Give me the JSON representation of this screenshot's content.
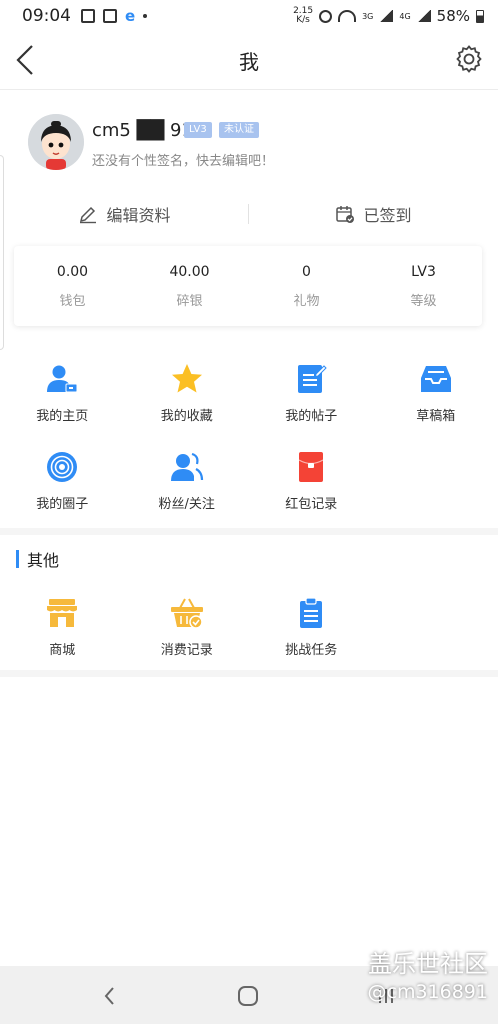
{
  "status_bar": {
    "time": "09:04",
    "net_speed_top": "2.15",
    "net_speed_bottom": "K/s",
    "net_3g": "3G",
    "net_4g": "4G",
    "battery": "58%"
  },
  "header": {
    "title": "我"
  },
  "profile": {
    "username": "cm5 ██ 91",
    "level_badge": "LV3",
    "auth_badge": "未认证",
    "signature": "还没有个性签名，快去编辑吧！"
  },
  "actions": {
    "edit_profile": "编辑资料",
    "checked_in": "已签到"
  },
  "stats": [
    {
      "value": "0.00",
      "label": "钱包"
    },
    {
      "value": "40.00",
      "label": "碎银"
    },
    {
      "value": "0",
      "label": "礼物"
    },
    {
      "value": "LV3",
      "label": "等级"
    }
  ],
  "menu": [
    {
      "label": "我的主页",
      "icon": "profile-card-icon"
    },
    {
      "label": "我的收藏",
      "icon": "star-icon"
    },
    {
      "label": "我的帖子",
      "icon": "edit-document-icon"
    },
    {
      "label": "草稿箱",
      "icon": "inbox-tray-icon"
    },
    {
      "label": "我的圈子",
      "icon": "circle-target-icon"
    },
    {
      "label": "粉丝/关注",
      "icon": "fans-follow-icon"
    },
    {
      "label": "红包记录",
      "icon": "red-envelope-icon"
    }
  ],
  "other": {
    "title": "其他",
    "items": [
      {
        "label": "商城",
        "icon": "shop-icon"
      },
      {
        "label": "消费记录",
        "icon": "shopping-basket-icon"
      },
      {
        "label": "挑战任务",
        "icon": "task-clipboard-icon"
      }
    ]
  },
  "watermark": {
    "line1": "盖乐世社区",
    "line2": "@cm316891"
  },
  "colors": {
    "accent_blue": "#2f8cf5",
    "star_yellow": "#fbbf24",
    "red": "#f44336",
    "orange": "#f6b93b"
  }
}
